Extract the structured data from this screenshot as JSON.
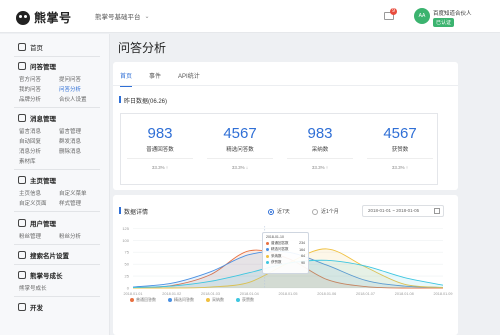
{
  "topbar": {
    "logo": "熊掌号",
    "platform": "熊掌号基础平台",
    "notification_count": "9",
    "avatar_text": "AA",
    "user_name": "百度知道合伙人",
    "user_tag": "已认证"
  },
  "sidebar": {
    "home": "首页",
    "sections": [
      {
        "title": "问答管理",
        "items": [
          "官方问答",
          "我的问答",
          "品牌分析",
          "提问问答",
          "问答分析",
          "合伙人设置"
        ]
      },
      {
        "title": "消息管理",
        "items": [
          "留言消息",
          "自动回复",
          "消息分析",
          "素材库",
          "留言管理",
          "群发消息",
          "删除消息"
        ]
      },
      {
        "title": "主页管理",
        "items": [
          "主页信息",
          "自定义菜单",
          "自定义页面",
          "样式管理"
        ]
      },
      {
        "title": "用户管理",
        "items": [
          "粉丝管理",
          "粉丝分析"
        ]
      },
      {
        "title": "搜索名片设置",
        "items": []
      },
      {
        "title": "熊掌号成长",
        "items": [
          "熊掌号成长"
        ]
      },
      {
        "title": "开发",
        "items": []
      }
    ]
  },
  "main": {
    "title": "问答分析",
    "tabs": [
      "首页",
      "事件",
      "API统计"
    ],
    "yesterday_label": "昨日数据(06.26)",
    "stats": [
      {
        "value": "983",
        "label": "普通回答数",
        "pct": "33.3% ↑"
      },
      {
        "value": "4567",
        "label": "精选问答数",
        "pct": "33.3% ↓"
      },
      {
        "value": "983",
        "label": "采纳数",
        "pct": "33.3% ↑"
      },
      {
        "value": "4567",
        "label": "获赞数",
        "pct": "33.3% ↑"
      }
    ],
    "detail_label": "数据详情",
    "radio_7": "近7天",
    "radio_30": "近1个月",
    "date_range": "2018-01-01 ~ 2018-01-05"
  },
  "tooltip": {
    "date": "2018-01-10",
    "rows": [
      {
        "name": "普通回答数",
        "value": "234"
      },
      {
        "name": "精选问答数",
        "value": "164"
      },
      {
        "name": "采纳数",
        "value": "64"
      },
      {
        "name": "获赞数",
        "value": "90"
      }
    ]
  },
  "chart_data": {
    "type": "area",
    "x": [
      "2018.01.01",
      "2018.01.02",
      "2018.01.03",
      "2018.01.04",
      "2018.01.05",
      "2018.01.06",
      "2018.01.07",
      "2018.01.08",
      "2018.01.09"
    ],
    "y_ticks": [
      0,
      25,
      50,
      75,
      100,
      125
    ],
    "ylim": [
      0,
      130
    ],
    "series": [
      {
        "name": "普通回答数",
        "color": "#e87040",
        "values": [
          1,
          5,
          28,
          78,
          62,
          18,
          3,
          0,
          0
        ]
      },
      {
        "name": "精选问答数",
        "color": "#4a90e2",
        "values": [
          2,
          10,
          34,
          70,
          75,
          48,
          16,
          4,
          1
        ]
      },
      {
        "name": "采纳数",
        "color": "#f0c040",
        "values": [
          0,
          0,
          2,
          12,
          52,
          82,
          44,
          8,
          1
        ]
      },
      {
        "name": "获赞数",
        "color": "#3ec6e0",
        "values": [
          1,
          4,
          14,
          32,
          52,
          58,
          46,
          22,
          6
        ]
      }
    ]
  },
  "colors": {
    "accent": "#2f6fd6",
    "brand_green": "#3bb36f"
  }
}
